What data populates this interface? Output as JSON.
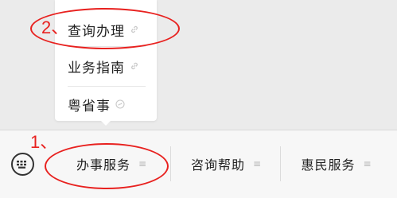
{
  "popup_menu": {
    "items": [
      {
        "label": "查询办理",
        "icon": "link-icon"
      },
      {
        "label": "业务指南",
        "icon": "link-icon"
      },
      {
        "label": "粤省事",
        "icon": "mini-program-icon"
      }
    ]
  },
  "tabbar": {
    "keyboard_icon": "keyboard-icon",
    "tabs": [
      {
        "label": "办事服务",
        "icon": "menu-icon"
      },
      {
        "label": "咨询帮助",
        "icon": "menu-icon"
      },
      {
        "label": "惠民服务",
        "icon": "menu-icon"
      }
    ]
  },
  "annotations": {
    "marker_1": "1、",
    "marker_2": "2、",
    "color": "#e8211f"
  }
}
